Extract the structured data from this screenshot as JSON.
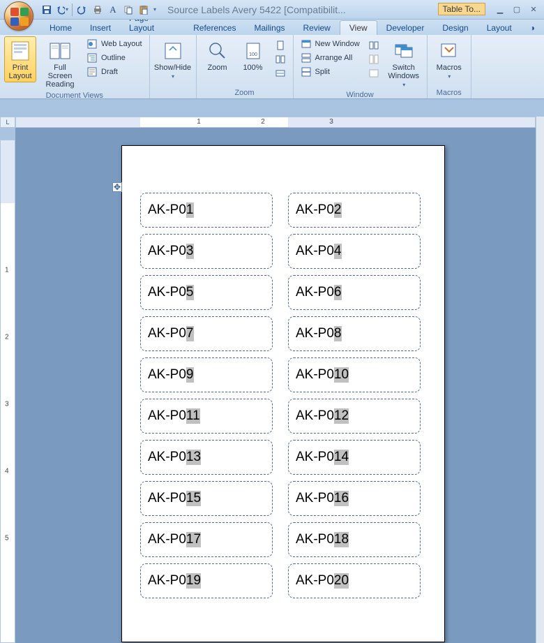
{
  "title": "Source Labels Avery 5422 [Compatibilit...",
  "table_tools_label": "Table To...",
  "qat": [
    {
      "name": "save-icon"
    },
    {
      "name": "undo-icon"
    },
    {
      "name": "redo-icon"
    },
    {
      "name": "quickprint-icon"
    },
    {
      "name": "font-icon"
    },
    {
      "name": "copy-icon"
    },
    {
      "name": "paste-icon"
    }
  ],
  "tabs": [
    "Home",
    "Insert",
    "Page Layout",
    "References",
    "Mailings",
    "Review",
    "View",
    "Developer",
    "Design",
    "Layout"
  ],
  "active_tab": "View",
  "ribbon": {
    "doc_views": {
      "label": "Document Views",
      "print_layout": "Print\nLayout",
      "full_screen": "Full Screen\nReading",
      "web_layout": "Web Layout",
      "outline": "Outline",
      "draft": "Draft"
    },
    "showhide": {
      "label": "Show/Hide"
    },
    "zoom": {
      "label": "Zoom",
      "zoom": "Zoom",
      "p100": "100%"
    },
    "window": {
      "label": "Window",
      "new_window": "New Window",
      "arrange_all": "Arrange All",
      "split": "Split",
      "switch": "Switch\nWindows"
    },
    "macros": {
      "label": "Macros",
      "btn": "Macros"
    }
  },
  "ruler": {
    "h_marks": [
      "1",
      "2",
      "3"
    ],
    "v_marks": [
      "1",
      "2",
      "3",
      "4",
      "5"
    ]
  },
  "document": {
    "labels": [
      [
        "AK-P0",
        "1",
        "AK-P0",
        "2"
      ],
      [
        "AK-P0",
        "3",
        "AK-P0",
        "4"
      ],
      [
        "AK-P0",
        "5",
        "AK-P0",
        "6"
      ],
      [
        "AK-P0",
        "7",
        "AK-P0",
        "8"
      ],
      [
        "AK-P0",
        "9",
        "AK-P0",
        "10"
      ],
      [
        "AK-P0",
        "11",
        "AK-P0",
        "12"
      ],
      [
        "AK-P0",
        "13",
        "AK-P0",
        "14"
      ],
      [
        "AK-P0",
        "15",
        "AK-P0",
        "16"
      ],
      [
        "AK-P0",
        "17",
        "AK-P0",
        "18"
      ],
      [
        "AK-P0",
        "19",
        "AK-P0",
        "20"
      ]
    ]
  }
}
